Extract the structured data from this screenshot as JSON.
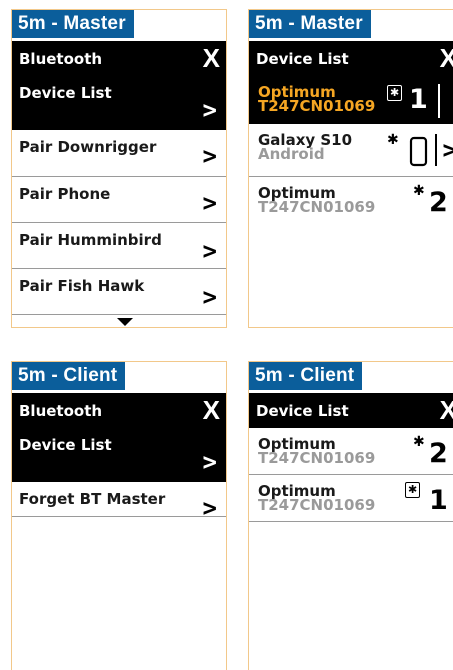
{
  "screen1": {
    "tag": "5m - Master",
    "header": {
      "title": "Bluetooth",
      "close": "X"
    },
    "items": [
      {
        "label": "Device List",
        "arrow": ">"
      },
      {
        "label": "Pair Downrigger",
        "arrow": ">"
      },
      {
        "label": "Pair Phone",
        "arrow": ">"
      },
      {
        "label": "Pair Humminbird",
        "arrow": ">"
      },
      {
        "label": "Pair Fish Hawk",
        "arrow": ">"
      }
    ]
  },
  "screen2": {
    "tag": "5m - Master",
    "header": {
      "title": "Device List",
      "close": "X"
    },
    "devices": [
      {
        "name": "Optimum",
        "sub": "T247CN01069",
        "number": "1"
      },
      {
        "name": "Galaxy S10",
        "sub": "Android",
        "arrow": ">"
      },
      {
        "name": "Optimum",
        "sub": "T247CN01069",
        "number": "2"
      }
    ]
  },
  "screen3": {
    "tag": "5m - Client",
    "header": {
      "title": "Bluetooth",
      "close": "X"
    },
    "items": [
      {
        "label": "Device List",
        "arrow": ">"
      },
      {
        "label": "Forget BT Master",
        "arrow": ">"
      }
    ]
  },
  "screen4": {
    "tag": "5m - Client",
    "header": {
      "title": "Device List",
      "close": "X"
    },
    "devices": [
      {
        "name": "Optimum",
        "sub": "T247CN01069",
        "number": "2"
      },
      {
        "name": "Optimum",
        "sub": "T247CN01069",
        "number": "1"
      }
    ]
  },
  "icons": {
    "bluetooth": "bluetooth-icon",
    "bluetooth_box": "bluetooth-box-icon",
    "phone": "phone-icon",
    "more": "chevron-down-icon"
  },
  "colors": {
    "tag_bg": "#0b5e9b",
    "selected_text": "#f5a623",
    "border": "#f2c88a",
    "sub_gray": "#9a9a9a"
  }
}
